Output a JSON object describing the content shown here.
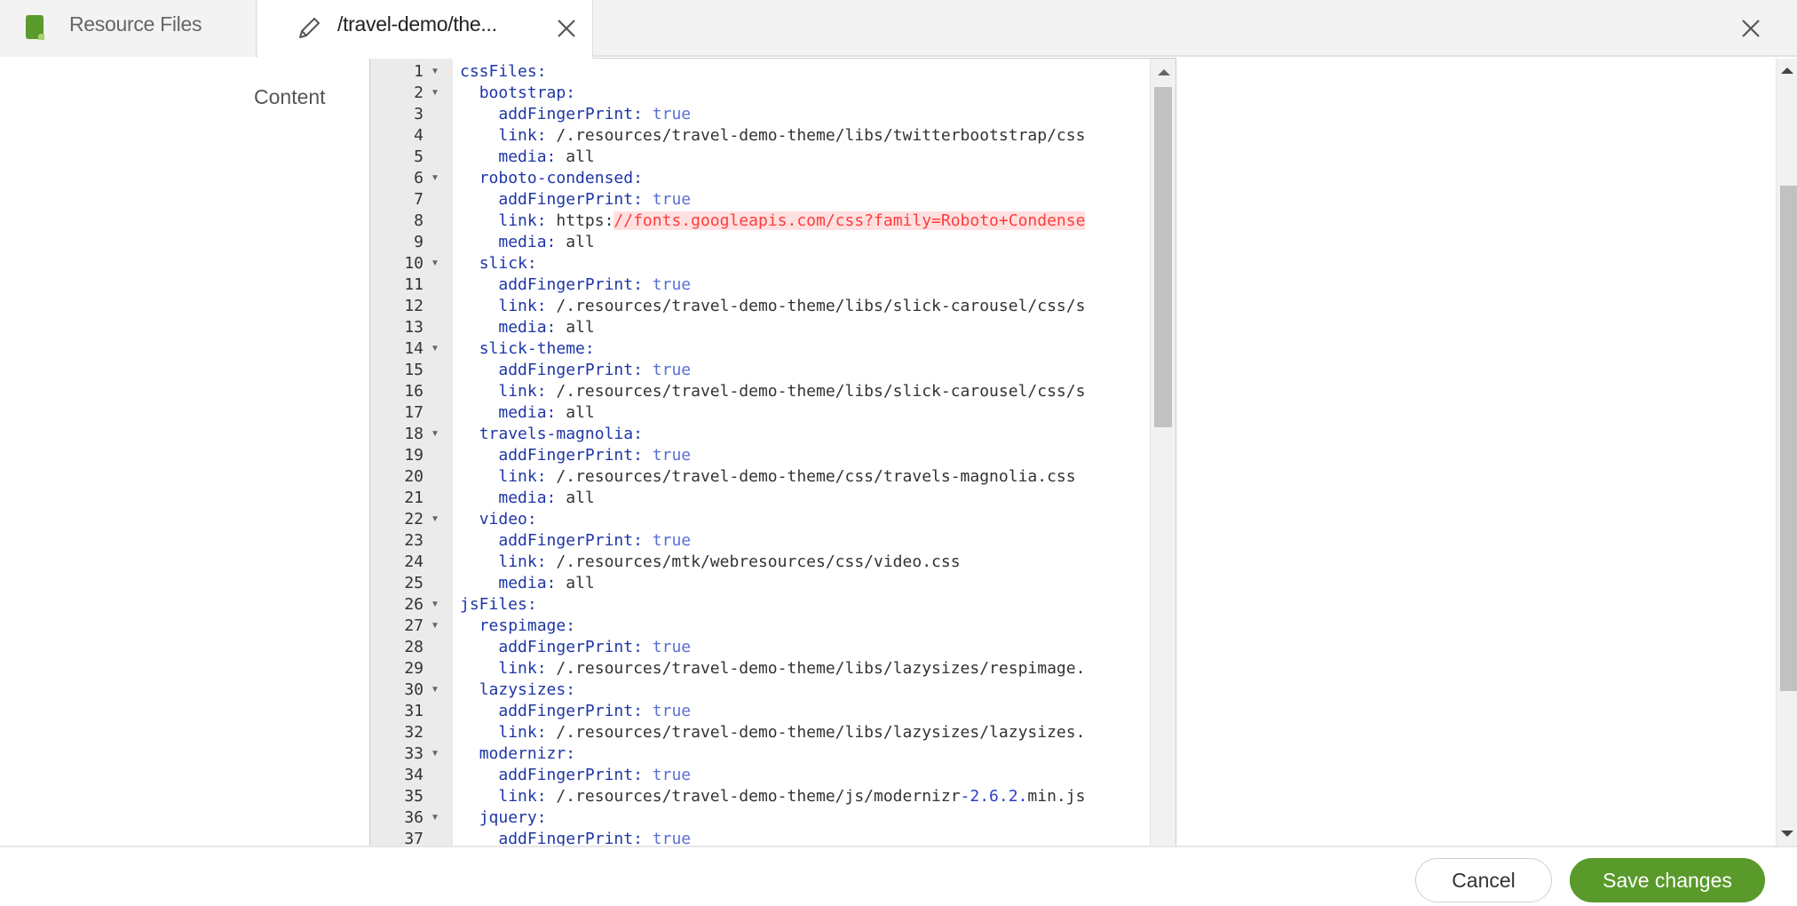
{
  "tabs": [
    {
      "label": "Resource Files",
      "icon": "resource-file-icon",
      "active": false
    },
    {
      "label": "/travel-demo/the...",
      "icon": "pencil-icon",
      "active": true,
      "closable": true
    }
  ],
  "window_close_icon": "close-icon",
  "form": {
    "content_label": "Content"
  },
  "editor": {
    "language": "yaml",
    "colors": {
      "key": "#1e36a6",
      "boolean": "#5a6fd6",
      "value": "#333333",
      "number": "#2a3ec8",
      "error": "#ff3b3b"
    },
    "lines": [
      {
        "n": "1",
        "fold": true,
        "indent": 0,
        "key": "cssFiles:",
        "val": ""
      },
      {
        "n": "2",
        "fold": true,
        "indent": 1,
        "key": "bootstrap:",
        "val": ""
      },
      {
        "n": "3",
        "fold": false,
        "indent": 2,
        "key": "addFingerPrint:",
        "bool": "true"
      },
      {
        "n": "4",
        "fold": false,
        "indent": 2,
        "key": "link:",
        "val": "/.resources/travel-demo-theme/libs/twitterbootstrap/css"
      },
      {
        "n": "5",
        "fold": false,
        "indent": 2,
        "key": "media:",
        "val": "all"
      },
      {
        "n": "6",
        "fold": true,
        "indent": 1,
        "key": "roboto-condensed:",
        "val": ""
      },
      {
        "n": "7",
        "fold": false,
        "indent": 2,
        "key": "addFingerPrint:",
        "bool": "true"
      },
      {
        "n": "8",
        "fold": false,
        "indent": 2,
        "key": "link:",
        "val": "https:",
        "err": "//fonts.googleapis.com/css?family=Roboto+Condense"
      },
      {
        "n": "9",
        "fold": false,
        "indent": 2,
        "key": "media:",
        "val": "all"
      },
      {
        "n": "10",
        "fold": true,
        "indent": 1,
        "key": "slick:",
        "val": ""
      },
      {
        "n": "11",
        "fold": false,
        "indent": 2,
        "key": "addFingerPrint:",
        "bool": "true"
      },
      {
        "n": "12",
        "fold": false,
        "indent": 2,
        "key": "link:",
        "val": "/.resources/travel-demo-theme/libs/slick-carousel/css/s"
      },
      {
        "n": "13",
        "fold": false,
        "indent": 2,
        "key": "media:",
        "val": "all"
      },
      {
        "n": "14",
        "fold": true,
        "indent": 1,
        "key": "slick-theme:",
        "val": ""
      },
      {
        "n": "15",
        "fold": false,
        "indent": 2,
        "key": "addFingerPrint:",
        "bool": "true"
      },
      {
        "n": "16",
        "fold": false,
        "indent": 2,
        "key": "link:",
        "val": "/.resources/travel-demo-theme/libs/slick-carousel/css/s"
      },
      {
        "n": "17",
        "fold": false,
        "indent": 2,
        "key": "media:",
        "val": "all"
      },
      {
        "n": "18",
        "fold": true,
        "indent": 1,
        "key": "travels-magnolia:",
        "val": ""
      },
      {
        "n": "19",
        "fold": false,
        "indent": 2,
        "key": "addFingerPrint:",
        "bool": "true"
      },
      {
        "n": "20",
        "fold": false,
        "indent": 2,
        "key": "link:",
        "val": "/.resources/travel-demo-theme/css/travels-magnolia.css"
      },
      {
        "n": "21",
        "fold": false,
        "indent": 2,
        "key": "media:",
        "val": "all"
      },
      {
        "n": "22",
        "fold": true,
        "indent": 1,
        "key": "video:",
        "val": ""
      },
      {
        "n": "23",
        "fold": false,
        "indent": 2,
        "key": "addFingerPrint:",
        "bool": "true"
      },
      {
        "n": "24",
        "fold": false,
        "indent": 2,
        "key": "link:",
        "val": "/.resources/mtk/webresources/css/video.css"
      },
      {
        "n": "25",
        "fold": false,
        "indent": 2,
        "key": "media:",
        "val": "all"
      },
      {
        "n": "26",
        "fold": true,
        "indent": 0,
        "key": "jsFiles:",
        "val": ""
      },
      {
        "n": "27",
        "fold": true,
        "indent": 1,
        "key": "respimage:",
        "val": ""
      },
      {
        "n": "28",
        "fold": false,
        "indent": 2,
        "key": "addFingerPrint:",
        "bool": "true"
      },
      {
        "n": "29",
        "fold": false,
        "indent": 2,
        "key": "link:",
        "val": "/.resources/travel-demo-theme/libs/lazysizes/respimage."
      },
      {
        "n": "30",
        "fold": true,
        "indent": 1,
        "key": "lazysizes:",
        "val": ""
      },
      {
        "n": "31",
        "fold": false,
        "indent": 2,
        "key": "addFingerPrint:",
        "bool": "true"
      },
      {
        "n": "32",
        "fold": false,
        "indent": 2,
        "key": "link:",
        "val": "/.resources/travel-demo-theme/libs/lazysizes/lazysizes."
      },
      {
        "n": "33",
        "fold": true,
        "indent": 1,
        "key": "modernizr:",
        "val": ""
      },
      {
        "n": "34",
        "fold": false,
        "indent": 2,
        "key": "addFingerPrint:",
        "bool": "true"
      },
      {
        "n": "35",
        "fold": false,
        "indent": 2,
        "key": "link:",
        "val": "/.resources/travel-demo-theme/js/modernizr",
        "num": "-2.6.2.",
        "tail": "min.js"
      },
      {
        "n": "36",
        "fold": true,
        "indent": 1,
        "key": "jquery:",
        "val": ""
      },
      {
        "n": "37",
        "fold": false,
        "indent": 2,
        "key": "addFingerPrint:",
        "bool": "true"
      }
    ]
  },
  "footer": {
    "cancel_label": "Cancel",
    "save_label": "Save changes"
  }
}
